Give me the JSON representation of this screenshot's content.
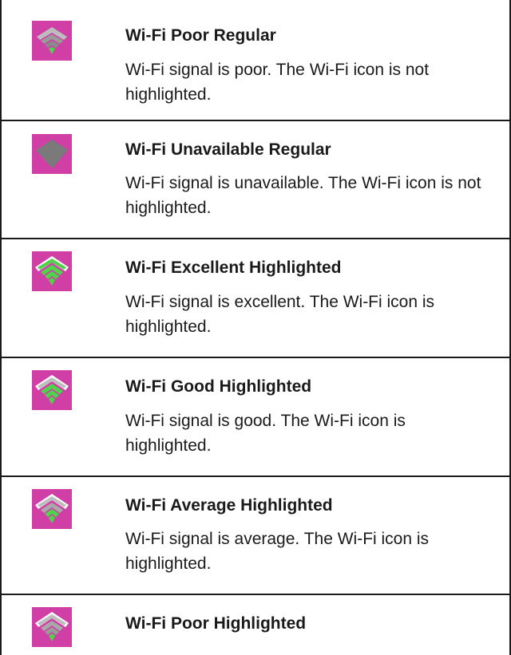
{
  "rows": [
    {
      "icon": "wifi-poor-regular-icon",
      "title": "Wi-Fi Poor Regular",
      "description": "Wi-Fi signal is poor. The Wi-Fi icon is not highlighted."
    },
    {
      "icon": "wifi-unavailable-regular-icon",
      "title": "Wi-Fi Unavailable Regular",
      "description": "Wi-Fi signal is unavailable. The Wi-Fi icon is not highlighted."
    },
    {
      "icon": "wifi-excellent-highlighted-icon",
      "title": "Wi-Fi Excellent Highlighted",
      "description": "Wi-Fi signal is excellent. The Wi-Fi icon is highlighted."
    },
    {
      "icon": "wifi-good-highlighted-icon",
      "title": "Wi-Fi Good Highlighted",
      "description": "Wi-Fi signal is good. The Wi-Fi icon is highlighted."
    },
    {
      "icon": "wifi-average-highlighted-icon",
      "title": "Wi-Fi Average Highlighted",
      "description": "Wi-Fi signal is average. The Wi-Fi icon is highlighted."
    },
    {
      "icon": "wifi-poor-highlighted-icon",
      "title": "Wi-Fi Poor Highlighted",
      "description": ""
    }
  ],
  "colors": {
    "icon_background": "#cf3fa6",
    "signal_lit": "#4fd34a",
    "signal_dim": "#a9a9a9",
    "signal_unavailable": "#7a7a7a"
  }
}
